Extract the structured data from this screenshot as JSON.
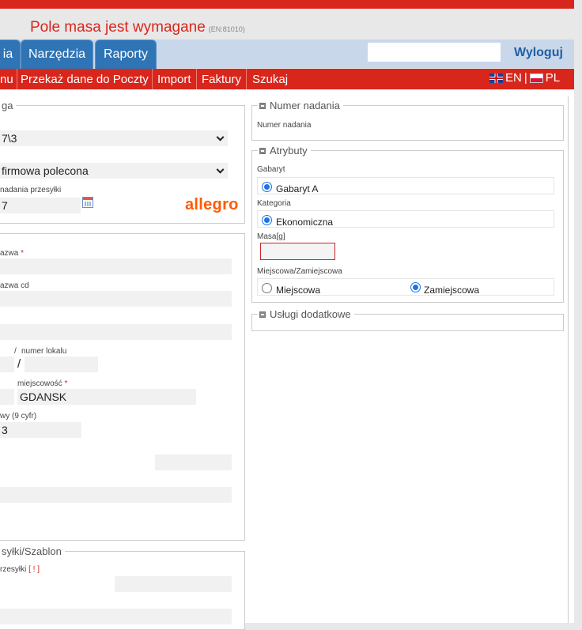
{
  "error": {
    "message": "Pole masa jest wymagane",
    "code": "(EN:81010)"
  },
  "nav": {
    "tabs": [
      {
        "label": "ia"
      },
      {
        "label": "Narzędzia"
      },
      {
        "label": "Raporty"
      }
    ],
    "search_placeholder": "",
    "logout": "Wyloguj"
  },
  "menu": {
    "items": [
      "nu",
      "Przekaż dane do Poczty",
      "Import",
      "Faktury",
      "Szukaj"
    ],
    "lang_en": "EN",
    "lang_sep": "|",
    "lang_pl": "PL"
  },
  "left": {
    "top_legend": "ga",
    "select1": "7\\3",
    "select2": "firmowa polecona",
    "date_label": "nadania przesyłki",
    "date_value": "7",
    "allegro": "allegro",
    "addr": {
      "nazwa_label": "azwa",
      "nazwa_value": "",
      "nazwa_cd_label": "azwa cd",
      "slash_small": "/",
      "numer_lokalu_label": "numer lokalu",
      "slash_big": "/",
      "miejscowosc_label": "miejscowość",
      "miejscowosc_value": "GDANSK",
      "phone_label": "wy (9 cyfr)",
      "phone_value": "3",
      "required_mark": "*"
    },
    "bottom_legend": "syłki/Szablon",
    "bottom_label": "rzesyłki",
    "bottom_flag": "[ ! ]"
  },
  "right": {
    "numer_nadania": {
      "legend": "Numer nadania",
      "label": "Numer nadania"
    },
    "atrybuty": {
      "legend": "Atrybuty",
      "gabaryt_label": "Gabaryt",
      "gabaryt_option": "Gabaryt A",
      "kategoria_label": "Kategoria",
      "kategoria_option": "Ekonomiczna",
      "masa_label": "Masa[g]",
      "masa_value": "",
      "miejscowa_label": "Miejscowa/Zamiejscowa",
      "opt_miejscowa": "Miejscowa",
      "opt_zamiejscowa": "Zamiejscowa"
    },
    "uslugi": {
      "legend": "Usługi dodatkowe"
    }
  },
  "colors": {
    "accent_red": "#d9261c",
    "tab_blue": "#2f74b5",
    "allegro_orange": "#ff5a00",
    "radio_blue": "#1a73e8"
  }
}
